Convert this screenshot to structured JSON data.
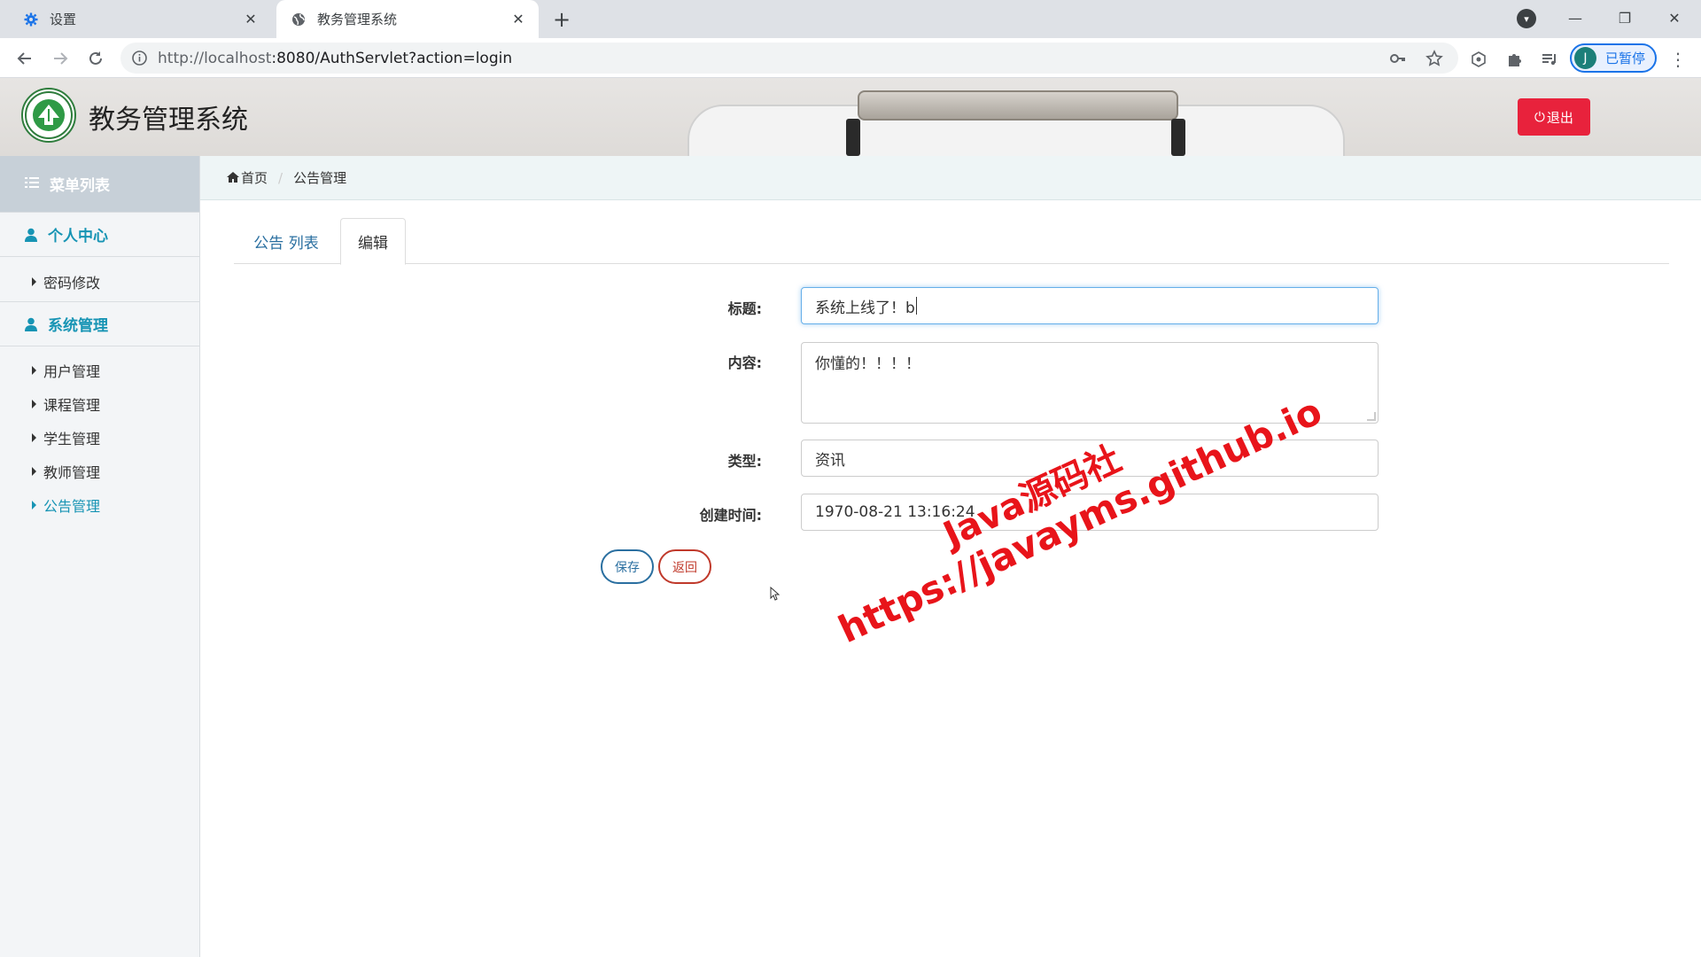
{
  "browser": {
    "tabs": [
      {
        "title": "设置",
        "active": false
      },
      {
        "title": "教务管理系统",
        "active": true
      }
    ],
    "url_host": "http://localhost",
    "url_rest": ":8080/AuthServlet?action=login",
    "profile_initial": "J",
    "profile_label": "已暂停"
  },
  "header": {
    "app_title": "教务管理系统",
    "logout_label": "退出",
    "logout_color": "#e8223c"
  },
  "sidebar": {
    "menu_title": "菜单列表",
    "sections": [
      {
        "label": "个人中心",
        "items": [
          "密码修改"
        ]
      },
      {
        "label": "系统管理",
        "items": [
          "用户管理",
          "课程管理",
          "学生管理",
          "教师管理",
          "公告管理"
        ]
      }
    ],
    "active_item": "公告管理",
    "accent_color": "#1794b4"
  },
  "breadcrumb": {
    "home": "首页",
    "current": "公告管理"
  },
  "content_tabs": {
    "list": "公告 列表",
    "edit": "编辑"
  },
  "form": {
    "title_label": "标题:",
    "title_value": "系统上线了！b",
    "content_label": "内容:",
    "content_value": "你懂的！！！！",
    "type_label": "类型:",
    "type_value": "资讯",
    "created_label": "创建时间:",
    "created_value": "1970-08-21 13:16:24",
    "save_label": "保存",
    "back_label": "返回"
  },
  "watermark": {
    "line1": "Java源码社",
    "line2": "https://javayms.github.io"
  }
}
